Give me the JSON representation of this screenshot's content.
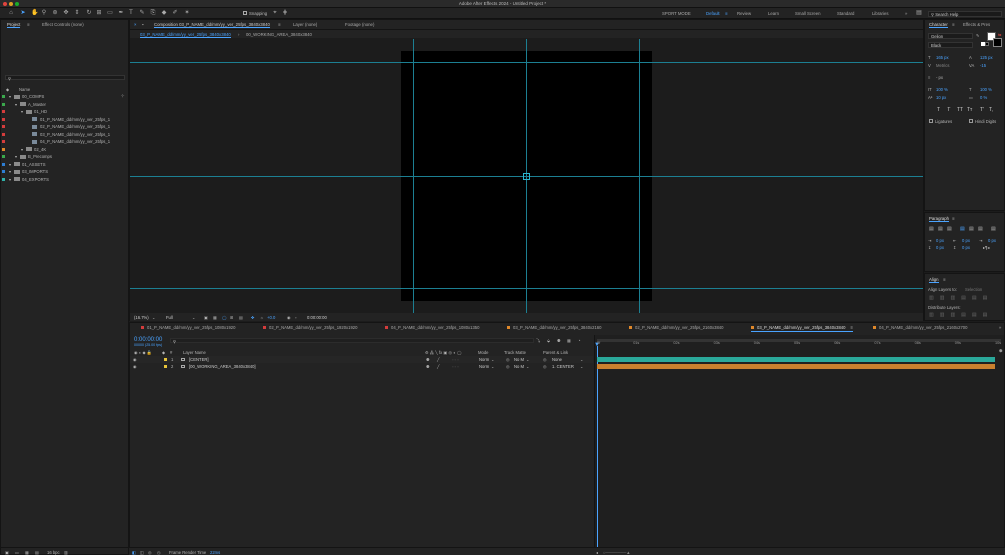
{
  "app": {
    "title": "Adobe After Effects 2024 - Untitled Project *"
  },
  "toolbar": {
    "snapping_label": "Snapping",
    "workspaces": [
      "SPORT MODE",
      "Default",
      "Review",
      "Learn",
      "Small Screen",
      "Standard",
      "Libraries"
    ],
    "active_workspace": "Default",
    "search_placeholder": "Search Help"
  },
  "project_panel": {
    "tabs": [
      "Project",
      "Effect Controls (none)"
    ],
    "name_header": "Name",
    "items": [
      {
        "name": "00_COMPS",
        "indent": 0,
        "type": "folder",
        "color": "#3aa84c"
      },
      {
        "name": "A_Master",
        "indent": 1,
        "type": "folder",
        "color": "#3aa84c"
      },
      {
        "name": "01_HD",
        "indent": 2,
        "type": "folder",
        "color": "#d43c3c"
      },
      {
        "name": "01_P_NAME_dd/mm/yy_ver_25fps_1",
        "indent": 3,
        "type": "comp",
        "color": "#d43c3c"
      },
      {
        "name": "02_P_NAME_dd/mm/yy_ver_25fps_1",
        "indent": 3,
        "type": "comp",
        "color": "#d43c3c"
      },
      {
        "name": "03_P_NAME_dd/mm/yy_ver_25fps_1",
        "indent": 3,
        "type": "comp",
        "color": "#d43c3c"
      },
      {
        "name": "04_P_NAME_dd/mm/yy_ver_25fps_1",
        "indent": 3,
        "type": "comp",
        "color": "#d43c3c"
      },
      {
        "name": "02_4K",
        "indent": 2,
        "type": "folder",
        "color": "#e0882a"
      },
      {
        "name": "B_Precomps",
        "indent": 1,
        "type": "folder",
        "color": "#3aa84c"
      },
      {
        "name": "01_ASSETS",
        "indent": 0,
        "type": "folder",
        "color": "#2d7dd2"
      },
      {
        "name": "03_IMPORTS",
        "indent": 0,
        "type": "folder",
        "color": "#2d7dd2"
      },
      {
        "name": "04_EXPORTS",
        "indent": 0,
        "type": "folder",
        "color": "#2fb0a8"
      }
    ],
    "footer_bpc": "16 bpc"
  },
  "viewer": {
    "tabs": [
      {
        "label": "Composition 03_P_NAME_dd/mm/yy_ver_25fps_3840x3840",
        "active": true
      },
      {
        "label": "Layer (none)",
        "active": false
      },
      {
        "label": "Footage (none)",
        "active": false
      }
    ],
    "subtabs": [
      "03_P_NAME_dd/mm/yy_ver_25fps_3840x3840",
      "00_WORKING_AREA_3840x3840"
    ],
    "zoom": "(16.7%)",
    "resolution": "Full",
    "exposure": "+0.0",
    "timecode": "0:00:00:00"
  },
  "character": {
    "tabs": [
      "Character",
      "Effects & Pres"
    ],
    "font": "Gelion",
    "style": "Black",
    "size": "165 px",
    "leading": "125 px",
    "tracking_metrics": "Metrics",
    "tracking": "-15",
    "unit": "- px",
    "vert_scale": "100 %",
    "horiz_scale": "100 %",
    "baseline": "10 px",
    "tsume": "0 %",
    "glyphs": [
      "T",
      "T",
      "TT",
      "Tт",
      "T'",
      "T,"
    ],
    "ligatures": "Ligatures",
    "hindi_digits": "Hindi Digits"
  },
  "paragraph": {
    "title": "Paragraph",
    "indent_left": "0 px",
    "indent_first": "0 px",
    "indent_right": "0 px",
    "space_before": "0 px",
    "space_after": "0 px"
  },
  "align": {
    "title": "Align",
    "align_to_label": "Align Layers to:",
    "align_to_value": "Selection",
    "distribute_label": "Distribute Layers:"
  },
  "timeline": {
    "tabs": [
      {
        "label": "01_P_NAME_dd/mm/yy_ver_25fps_1080x1920",
        "color": "#d43c3c"
      },
      {
        "label": "02_P_NAME_dd/mm/yy_ver_25fps_1920x1920",
        "color": "#d43c3c"
      },
      {
        "label": "04_P_NAME_dd/mm/yy_ver_25fps_1080x1350",
        "color": "#d43c3c"
      },
      {
        "label": "03_P_NAME_dd/mm/yy_ver_25fps_3840x2160",
        "color": "#e0882a"
      },
      {
        "label": "02_P_NAME_dd/mm/yy_ver_25fps_2160x3840",
        "color": "#e0882a"
      },
      {
        "label": "03_P_NAME_dd/mm/yy_ver_25fps_3840x3840",
        "color": "#e0882a"
      },
      {
        "label": "04_P_NAME_dd/mm/yy_ver_25fps_2160x2700",
        "color": "#e0882a"
      }
    ],
    "active_tab": 5,
    "current_time": "0:00:00:00",
    "frame_info": "00000 (25.00 fps)",
    "columns": {
      "layer_name": "Layer Name",
      "mode": "Mode",
      "track_matte": "Track Matte",
      "parent": "Parent & Link"
    },
    "layers": [
      {
        "num": "1",
        "name": "[CENTER]",
        "color": "#e6c43a",
        "mode": "Norm",
        "matte": "No M",
        "parent": "None"
      },
      {
        "num": "2",
        "name": "[00_WORKING_AREA_3840x3840]",
        "color": "#e6c43a",
        "mode": "Norm",
        "matte": "No M",
        "parent": "1. CENTER"
      }
    ],
    "ruler": [
      "0f",
      "01s",
      "02s",
      "03s",
      "04s",
      "05s",
      "06s",
      "07s",
      "08s",
      "09s",
      "10s"
    ],
    "bar_colors": [
      "#2aa89a",
      "#c8802e"
    ],
    "footer_render_label": "Frame Render Time",
    "footer_render_value": "22ms"
  }
}
